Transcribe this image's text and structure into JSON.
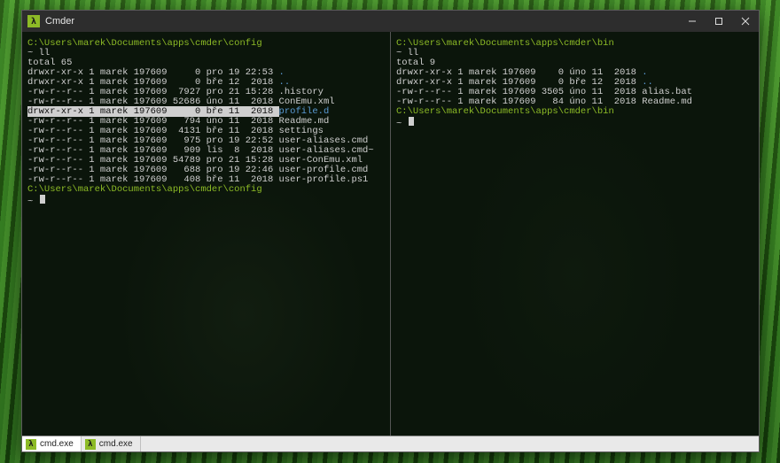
{
  "titlebar": {
    "app_title": "Cmder",
    "icon_glyph": "λ"
  },
  "window_buttons": {
    "min": "—",
    "max": "▢",
    "close": "✕"
  },
  "tabs": [
    {
      "label": "cmd.exe",
      "active": true
    },
    {
      "label": "cmd.exe",
      "active": false
    }
  ],
  "left_pane": {
    "path1": "C:\\Users\\marek\\Documents\\apps\\cmder\\config",
    "cmd1": "~ ll",
    "total": "total 65",
    "rows": [
      {
        "meta": "drwxr-xr-x 1 marek 197609     0 pro 19 22:53 ",
        "name": ".",
        "cls": "dir"
      },
      {
        "meta": "drwxr-xr-x 1 marek 197609     0 bře 12  2018 ",
        "name": "..",
        "cls": "dir"
      },
      {
        "meta": "-rw-r--r-- 1 marek 197609  7927 pro 21 15:28 ",
        "name": ".history",
        "cls": ""
      },
      {
        "meta": "-rw-r--r-- 1 marek 197609 52686 úno 11  2018 ",
        "name": "ConEmu.xml",
        "cls": ""
      },
      {
        "meta": "drwxr-xr-x 1 marek 197609     0 bře 11  2018 ",
        "name": "profile.d",
        "cls": "dir",
        "hl": true
      },
      {
        "meta": "-rw-r--r-- 1 marek 197609   794 úno 11  2018 ",
        "name": "Readme.md",
        "cls": ""
      },
      {
        "meta": "-rw-r--r-- 1 marek 197609  4131 bře 11  2018 ",
        "name": "settings",
        "cls": ""
      },
      {
        "meta": "-rw-r--r-- 1 marek 197609   975 pro 19 22:52 ",
        "name": "user-aliases.cmd",
        "cls": ""
      },
      {
        "meta": "-rw-r--r-- 1 marek 197609   909 lis  8  2018 ",
        "name": "user-aliases.cmd~",
        "cls": ""
      },
      {
        "meta": "-rw-r--r-- 1 marek 197609 54789 pro 21 15:28 ",
        "name": "user-ConEmu.xml",
        "cls": ""
      },
      {
        "meta": "-rw-r--r-- 1 marek 197609   688 pro 19 22:46 ",
        "name": "user-profile.cmd",
        "cls": ""
      },
      {
        "meta": "-rw-r--r-- 1 marek 197609   408 bře 11  2018 ",
        "name": "user-profile.ps1",
        "cls": ""
      }
    ],
    "path2": "C:\\Users\\marek\\Documents\\apps\\cmder\\config",
    "prompt2": "~ "
  },
  "right_pane": {
    "path1": "C:\\Users\\marek\\Documents\\apps\\cmder\\bin",
    "cmd1": "~ ll",
    "total": "total 9",
    "rows": [
      {
        "meta": "drwxr-xr-x 1 marek 197609    0 úno 11  2018 ",
        "name": ".",
        "cls": "dir"
      },
      {
        "meta": "drwxr-xr-x 1 marek 197609    0 bře 12  2018 ",
        "name": "..",
        "cls": "dir"
      },
      {
        "meta": "-rw-r--r-- 1 marek 197609 3505 úno 11  2018 ",
        "name": "alias.bat",
        "cls": ""
      },
      {
        "meta": "-rw-r--r-- 1 marek 197609   84 úno 11  2018 ",
        "name": "Readme.md",
        "cls": ""
      }
    ],
    "path2": "C:\\Users\\marek\\Documents\\apps\\cmder\\bin",
    "prompt2": "~ "
  }
}
